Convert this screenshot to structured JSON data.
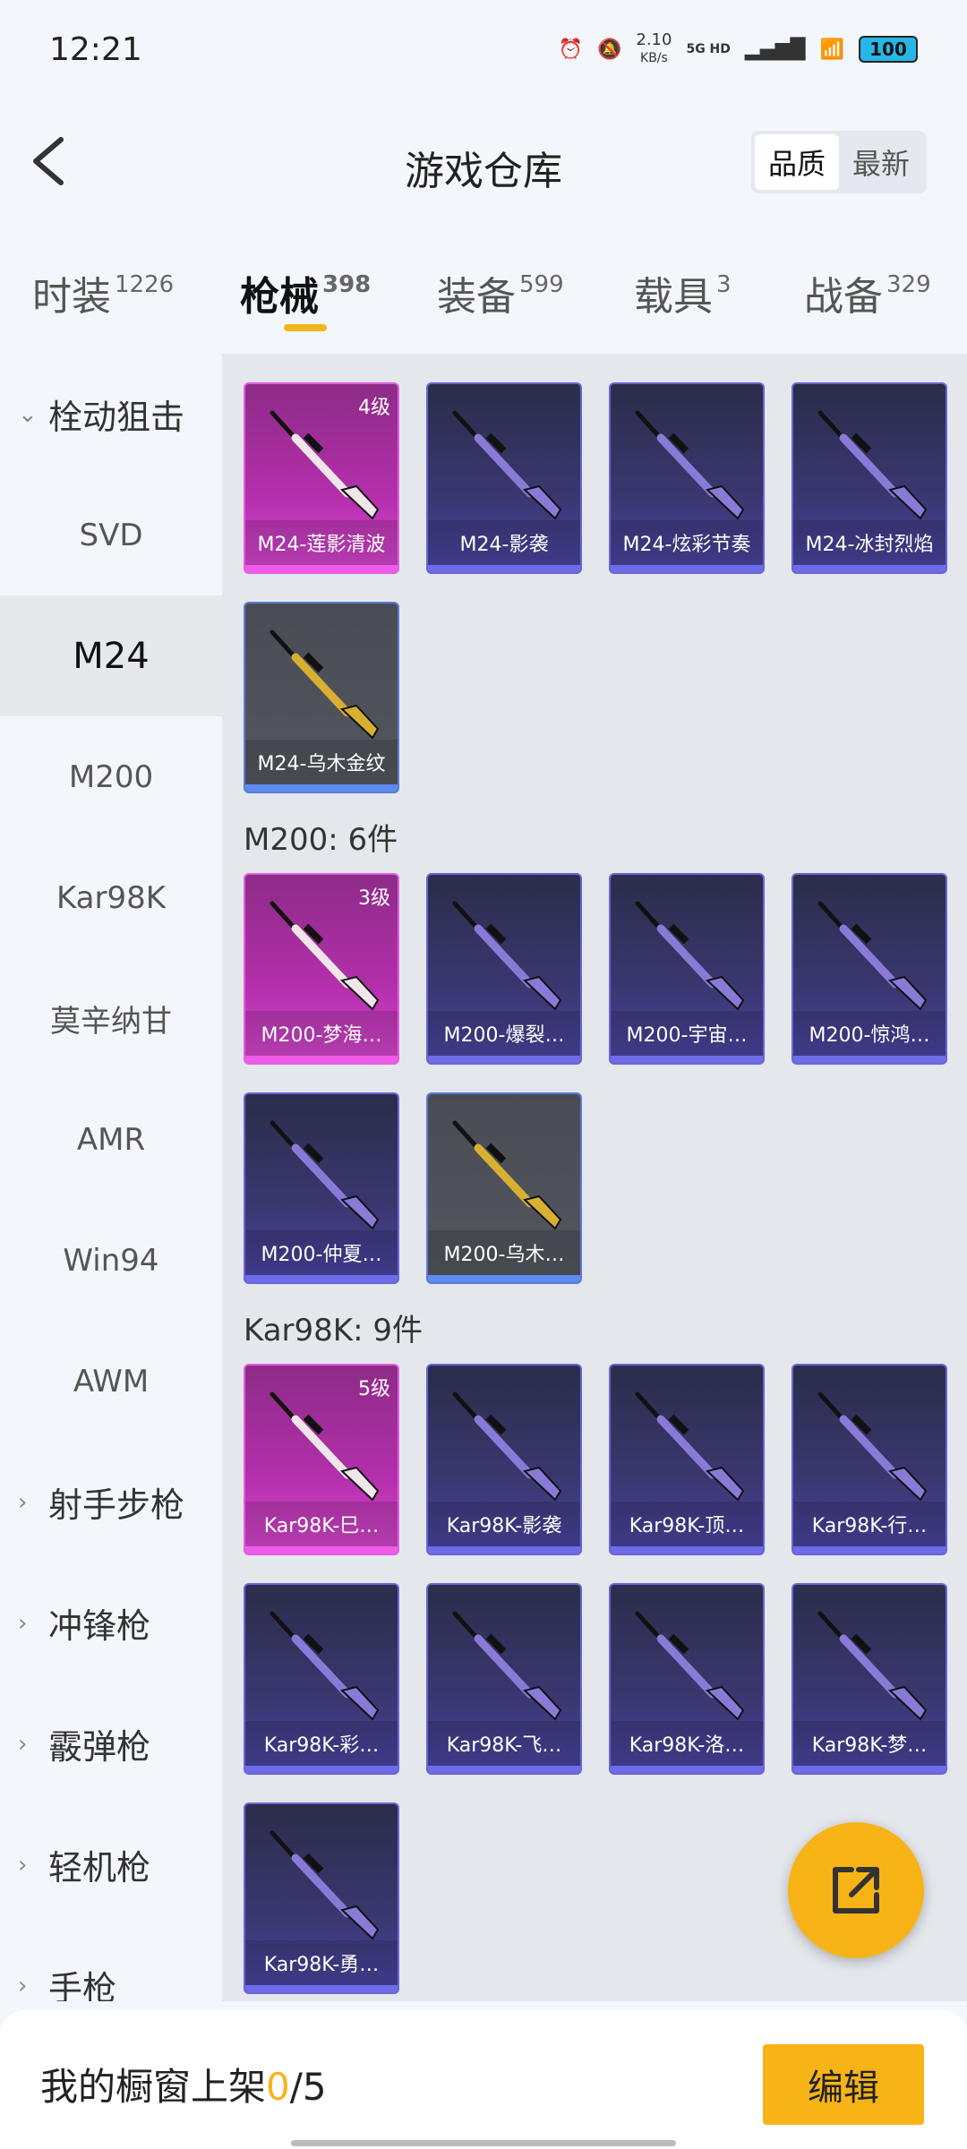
{
  "status": {
    "time": "12:21",
    "speed": "2.10",
    "speed_unit": "KB/s",
    "net": "5G HD",
    "battery": "100"
  },
  "header": {
    "title": "游戏仓库",
    "sort": [
      "品质",
      "最新"
    ]
  },
  "categories": [
    {
      "label": "时装",
      "count": "1226"
    },
    {
      "label": "枪械",
      "count": "398"
    },
    {
      "label": "装备",
      "count": "599"
    },
    {
      "label": "载具",
      "count": "3"
    },
    {
      "label": "战备",
      "count": "329"
    }
  ],
  "sidebar": {
    "group_open": "栓动狙击",
    "items": [
      "SVD",
      "M24",
      "M200",
      "Kar98K",
      "莫辛纳甘",
      "AMR",
      "Win94",
      "AWM"
    ],
    "groups": [
      "射手步枪",
      "冲锋枪",
      "霰弹枪",
      "轻机枪",
      "手枪"
    ]
  },
  "content": {
    "m200_title": "M200: 6件",
    "kar_title": "Kar98K: 9件",
    "m24_cards": [
      {
        "name": "M24-莲影清波",
        "level": "4级",
        "color": "pink"
      },
      {
        "name": "M24-影袭",
        "level": "",
        "color": "purple"
      },
      {
        "name": "M24-炫彩节奏",
        "level": "",
        "color": "purple"
      },
      {
        "name": "M24-冰封烈焰",
        "level": "",
        "color": "purple"
      },
      {
        "name": "M24-乌木金纹",
        "level": "",
        "color": "gray"
      }
    ],
    "m200_cards": [
      {
        "name": "M200-梦海…",
        "level": "3级",
        "color": "pink"
      },
      {
        "name": "M200-爆裂…",
        "level": "",
        "color": "purple"
      },
      {
        "name": "M200-宇宙…",
        "level": "",
        "color": "purple"
      },
      {
        "name": "M200-惊鸿…",
        "level": "",
        "color": "purple"
      },
      {
        "name": "M200-仲夏…",
        "level": "",
        "color": "purple"
      },
      {
        "name": "M200-乌木…",
        "level": "",
        "color": "gray"
      }
    ],
    "kar_cards": [
      {
        "name": "Kar98K-巳…",
        "level": "5级",
        "color": "pink"
      },
      {
        "name": "Kar98K-影袭",
        "level": "",
        "color": "purple"
      },
      {
        "name": "Kar98K-顶…",
        "level": "",
        "color": "purple"
      },
      {
        "name": "Kar98K-行…",
        "level": "",
        "color": "purple"
      },
      {
        "name": "Kar98K-彩…",
        "level": "",
        "color": "purple"
      },
      {
        "name": "Kar98K-飞…",
        "level": "",
        "color": "purple"
      },
      {
        "name": "Kar98K-洛…",
        "level": "",
        "color": "purple"
      },
      {
        "name": "Kar98K-梦…",
        "level": "",
        "color": "purple"
      },
      {
        "name": "Kar98K-勇…",
        "level": "",
        "color": "purple"
      }
    ]
  },
  "bottom": {
    "label": "我的橱窗上架",
    "count": "0",
    "total": "/5",
    "edit": "编辑"
  },
  "colors": {
    "accent": "#f8b416",
    "pink_rarity": "#d84ad1",
    "purple_rarity": "#4b46a6",
    "gray_rarity": "#55575f"
  }
}
